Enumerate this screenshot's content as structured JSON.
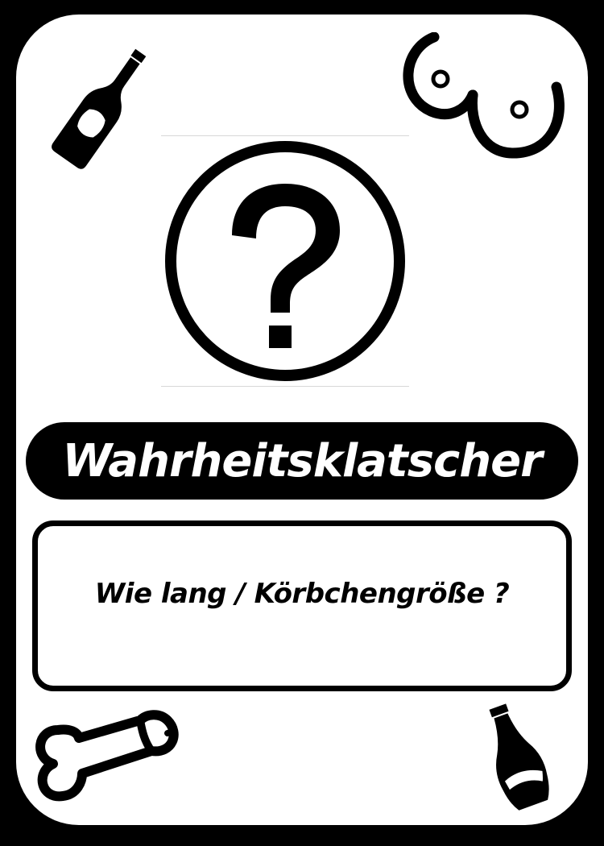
{
  "card": {
    "title": "Wahrheitsklatscher",
    "question": "Wie lang / Körbchengröße ?",
    "category_icon": "question-mark-circle-icon"
  },
  "corner_icons": {
    "top_left": "beer-bottle-icon",
    "top_right": "breasts-icon",
    "bottom_left": "penis-icon",
    "bottom_right": "cola-bottle-icon"
  },
  "colors": {
    "background": "#000000",
    "card": "#ffffff",
    "ink": "#000000"
  }
}
